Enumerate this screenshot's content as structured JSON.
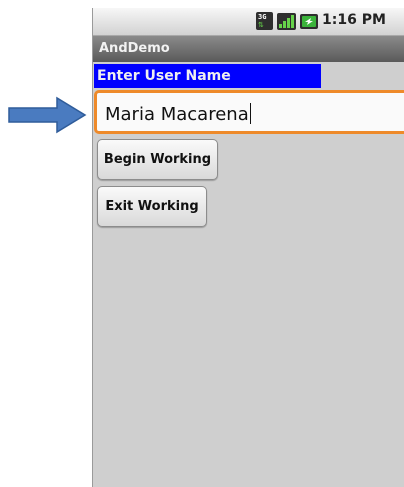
{
  "status_bar": {
    "network_badge": "3G",
    "time": "1:16 PM",
    "icons": [
      "3g-icon",
      "signal-icon",
      "battery-charging-icon"
    ]
  },
  "app": {
    "title": "AndDemo"
  },
  "form": {
    "label": "Enter User Name",
    "input_value": "Maria Macarena",
    "begin_button": "Begin Working",
    "exit_button": "Exit Working"
  },
  "colors": {
    "label_background": "#0000FF",
    "input_focus_border": "#EE8A2A",
    "pointer_arrow": "#4A7BC0",
    "battery": "#3BB33B"
  }
}
